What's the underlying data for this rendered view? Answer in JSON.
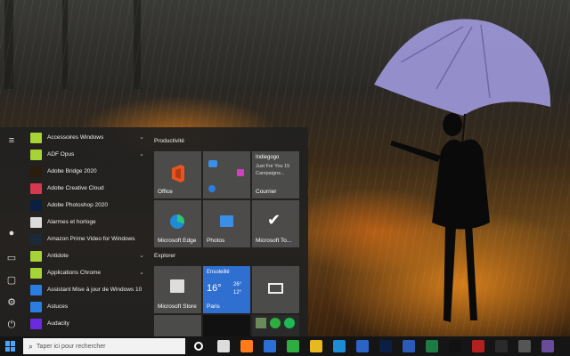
{
  "start_menu": {
    "rail": [
      {
        "icon": "hamburger-icon",
        "glyph": "≡"
      },
      {
        "icon": "user-avatar-icon",
        "glyph": "●"
      },
      {
        "icon": "document-icon",
        "glyph": "▭"
      },
      {
        "icon": "pictures-icon",
        "glyph": "▢"
      },
      {
        "icon": "settings-gear-icon",
        "glyph": "⚙"
      },
      {
        "icon": "power-icon",
        "glyph": "⏻"
      }
    ],
    "apps": [
      {
        "label": "Accessoires Windows",
        "icon": "folder-icon",
        "color": "#a6d437",
        "chevron": "⌄"
      },
      {
        "label": "ADF Opus",
        "icon": "folder-icon",
        "color": "#a6d437",
        "chevron": "⌄"
      },
      {
        "label": "Adobe Bridge 2020",
        "icon": "adobe-bridge-icon",
        "color": "#2b1d0e",
        "chevron": ""
      },
      {
        "label": "Adobe Creative Cloud",
        "icon": "creative-cloud-icon",
        "color": "#d6384f",
        "chevron": ""
      },
      {
        "label": "Adobe Photoshop 2020",
        "icon": "photoshop-icon",
        "color": "#0b1f44",
        "chevron": ""
      },
      {
        "label": "Alarmes et horloge",
        "icon": "alarm-clock-icon",
        "color": "#dcdcdc",
        "chevron": ""
      },
      {
        "label": "Amazon Prime Video for Windows",
        "icon": "prime-video-icon",
        "color": "#1a2a3a",
        "chevron": ""
      },
      {
        "label": "Antidote",
        "icon": "folder-icon",
        "color": "#a6d437",
        "chevron": "⌄"
      },
      {
        "label": "Applications Chrome",
        "icon": "folder-icon",
        "color": "#a6d437",
        "chevron": "⌄"
      },
      {
        "label": "Assistant Mise à jour de Windows 10",
        "icon": "windows-logo-icon",
        "color": "#2a7de1",
        "chevron": ""
      },
      {
        "label": "Astuces",
        "icon": "tips-icon",
        "color": "#2a7de1",
        "chevron": ""
      },
      {
        "label": "Audacity",
        "icon": "audacity-icon",
        "color": "#6a2adf",
        "chevron": ""
      }
    ],
    "groups": {
      "productivity": "Productivité",
      "explore": "Explorer"
    },
    "tiles": {
      "office": "Office",
      "indiegogo_title": "Indiegogo",
      "indiegogo_text": "Just For You 15 Campaigns...",
      "courrier": "Courrier",
      "edge": "Microsoft Edge",
      "photos": "Photos",
      "todo": "Microsoft To...",
      "store": "Microsoft Store",
      "weather_status": "Ensoleillé",
      "weather_temp": "16°",
      "weather_high": "26°",
      "weather_low": "12°",
      "weather_city": "Paris"
    }
  },
  "taskbar": {
    "search_placeholder": "Taper ici pour rechercher",
    "apps": [
      {
        "name": "cortana-icon",
        "color": "#ffffff"
      },
      {
        "name": "task-view-icon",
        "color": "#dddddd"
      },
      {
        "name": "firefox-icon",
        "color": "#ff7a1a"
      },
      {
        "name": "thunderbird-icon",
        "color": "#2a6fd6"
      },
      {
        "name": "xbox-icon",
        "color": "#2fae3f"
      },
      {
        "name": "chrome-icon",
        "color": "#e8b820"
      },
      {
        "name": "edge-icon",
        "color": "#1e8bd6"
      },
      {
        "name": "outlook-icon",
        "color": "#2b64c8"
      },
      {
        "name": "photoshop-icon",
        "color": "#0b1f44"
      },
      {
        "name": "word-icon",
        "color": "#2b5bb8"
      },
      {
        "name": "excel-icon",
        "color": "#1e7a43"
      },
      {
        "name": "netflix-icon",
        "color": "#111111"
      },
      {
        "name": "filezilla-icon",
        "color": "#b32020"
      },
      {
        "name": "terminal-icon",
        "color": "#2a2a2a"
      },
      {
        "name": "gog-icon",
        "color": "#555555"
      },
      {
        "name": "app-icon",
        "color": "#6a4a9a"
      }
    ]
  }
}
